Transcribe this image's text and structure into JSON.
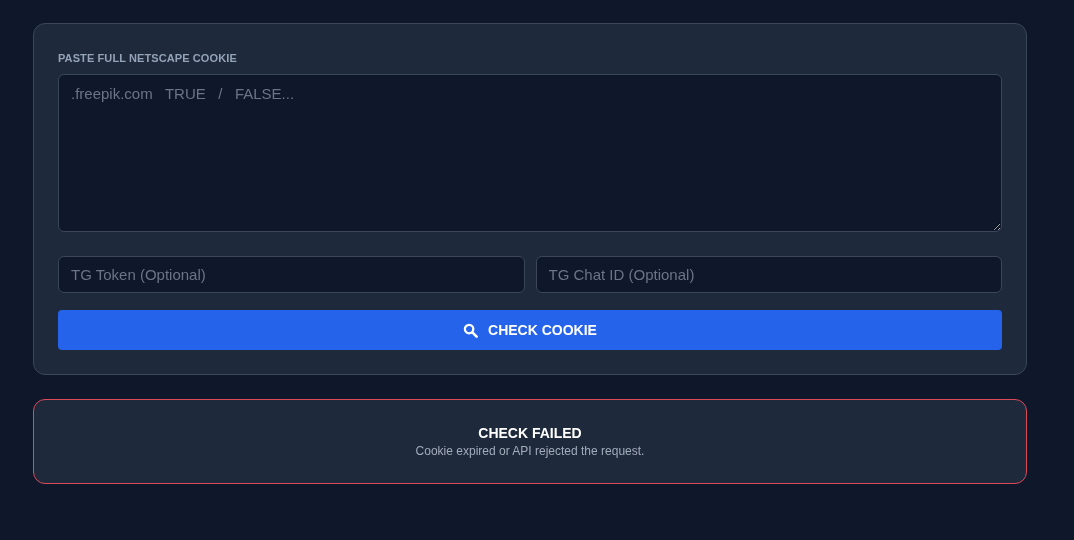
{
  "cookie_field": {
    "label": "PASTE FULL NETSCAPE COOKIE",
    "placeholder": ".freepik.com   TRUE   /   FALSE..."
  },
  "fields": [
    {
      "placeholder": "TG Token (Optional)"
    },
    {
      "placeholder": "TG Chat ID (Optional)"
    }
  ],
  "check_button": {
    "label": "CHECK COOKIE"
  },
  "result": {
    "kind": "error",
    "title": "CHECK FAILED",
    "message": "Cookie expired or API rejected the request."
  }
}
